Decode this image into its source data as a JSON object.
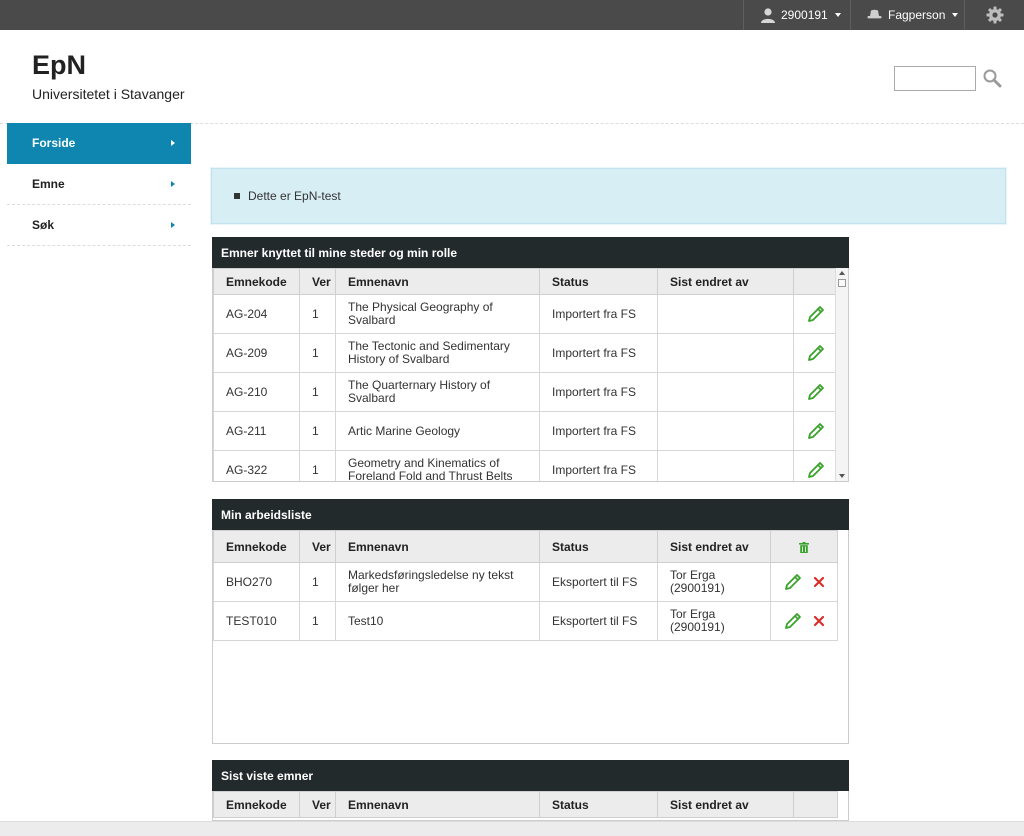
{
  "topbar": {
    "user_label": "2900191",
    "role_label": "Fagperson",
    "icons": [
      "user-icon",
      "role-icon",
      "gear-icon"
    ]
  },
  "header": {
    "app_title": "EpN",
    "institution": "Universitetet i Stavanger",
    "search_value": ""
  },
  "sidebar": {
    "items": [
      {
        "label": "Forside",
        "active": true
      },
      {
        "label": "Emne",
        "active": false
      },
      {
        "label": "Søk",
        "active": false
      }
    ]
  },
  "notice": {
    "text": "Dette er EpN-test"
  },
  "columns": {
    "emnekode": "Emnekode",
    "ver": "Ver",
    "emnenavn": "Emnenavn",
    "status": "Status",
    "sist_endret": "Sist endret av"
  },
  "panel1": {
    "title": "Emner knyttet til mine steder og min rolle",
    "rows": [
      {
        "code": "AG-204",
        "ver": "1",
        "name": "The Physical Geography of Svalbard",
        "status": "Importert fra FS",
        "changed_by": ""
      },
      {
        "code": "AG-209",
        "ver": "1",
        "name": "The Tectonic and Sedimentary History of Svalbard",
        "status": "Importert fra FS",
        "changed_by": ""
      },
      {
        "code": "AG-210",
        "ver": "1",
        "name": "The Quarternary History of Svalbard",
        "status": "Importert fra FS",
        "changed_by": ""
      },
      {
        "code": "AG-211",
        "ver": "1",
        "name": "Artic Marine Geology",
        "status": "Importert fra FS",
        "changed_by": ""
      },
      {
        "code": "AG-322",
        "ver": "1",
        "name": "Geometry and Kinematics of Foreland Fold and Thrust Belts",
        "status": "Importert fra FS",
        "changed_by": ""
      }
    ]
  },
  "panel2": {
    "title": "Min arbeidsliste",
    "rows": [
      {
        "code": "BHO270",
        "ver": "1",
        "name": "Markedsføringsledelse ny tekst følger her",
        "status": "Eksportert til FS",
        "changed_by": "Tor Erga (2900191)"
      },
      {
        "code": "TEST010",
        "ver": "1",
        "name": "Test10",
        "status": "Eksportert til FS",
        "changed_by": "Tor Erga (2900191)"
      }
    ]
  },
  "panel3": {
    "title": "Sist viste emner"
  },
  "colors": {
    "topbar": "#4a4a4a",
    "accent": "#0e86b0",
    "panel_header": "#232a2b",
    "notice_bg": "#d8eef5",
    "edit_green": "#3aa32b",
    "delete_red": "#d9302c"
  }
}
